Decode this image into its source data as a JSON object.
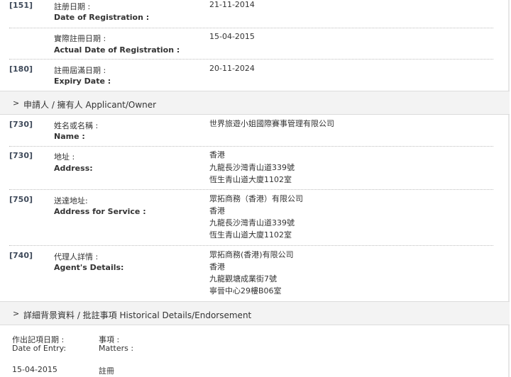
{
  "registration": {
    "fields": [
      {
        "code": "[151]",
        "label_zh": "註册日期 :",
        "label_en": "Date of Registration :",
        "values": [
          "21-11-2014"
        ]
      },
      {
        "code": "",
        "label_zh": "實際註冊日期 :",
        "label_en": "Actual Date of Registration :",
        "values": [
          "15-04-2015"
        ]
      },
      {
        "code": "[180]",
        "label_zh": "註冊屆滿日期 :",
        "label_en": "Expiry Date :",
        "values": [
          "20-11-2024"
        ]
      }
    ]
  },
  "applicant_section": {
    "chevron": ">",
    "title": "申請人 / 擁有人 Applicant/Owner",
    "fields": [
      {
        "code": "[730]",
        "label_zh": "姓名或名稱 :",
        "label_en": "Name :",
        "values": [
          "世界旅遊小姐國際賽事管理有限公司"
        ]
      },
      {
        "code": "[730]",
        "label_zh": "地址 :",
        "label_en": "Address:",
        "values": [
          "香港",
          "九龍長沙灣青山道339號",
          "恆生青山道大廈1102室"
        ]
      },
      {
        "code": "[750]",
        "label_zh": "送達地址:",
        "label_en": "Address for Service :",
        "values": [
          "眾拓商務（香港）有限公司",
          "香港",
          "九龍長沙灣青山道339號",
          "恆生青山道大廈1102室"
        ]
      },
      {
        "code": "[740]",
        "label_zh": "代理人詳情 :",
        "label_en": "Agent's Details:",
        "values": [
          "眾拓商務(香港)有限公司",
          "香港",
          "九龍觀塘成業街7號",
          "寧晉中心29樓B06室"
        ]
      }
    ]
  },
  "history_section": {
    "chevron": ">",
    "title": "詳細背景資料 / 批註事項 Historical Details/Endorsement",
    "date_header_zh": "作出記項日期 :",
    "date_header_en": "Date of Entry:",
    "matters_header_zh": "事項 :",
    "matters_header_en": "Matters :",
    "entries": [
      {
        "date": "15-04-2015",
        "matter": "註冊"
      }
    ]
  }
}
